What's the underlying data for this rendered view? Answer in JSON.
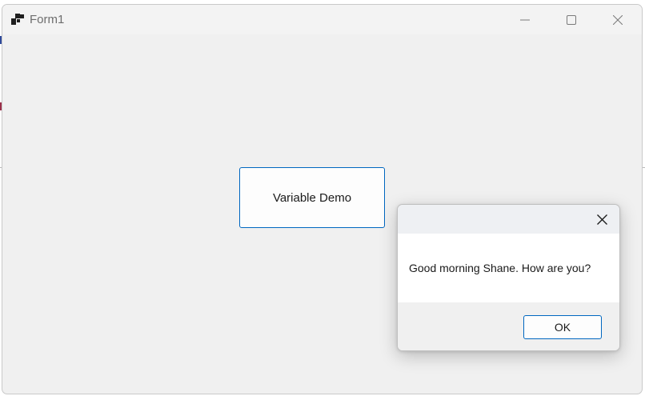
{
  "window": {
    "title": "Form1",
    "icon": "winforms-app-icon",
    "controls": {
      "minimize": "minimize-icon",
      "maximize": "maximize-icon",
      "close": "close-icon"
    }
  },
  "form": {
    "button_label": "Variable Demo"
  },
  "message_box": {
    "message": "Good morning Shane. How are you?",
    "ok_label": "OK",
    "close_icon": "close-icon"
  },
  "colors": {
    "accent": "#0067c0",
    "window_bg": "#f0f0f0"
  }
}
